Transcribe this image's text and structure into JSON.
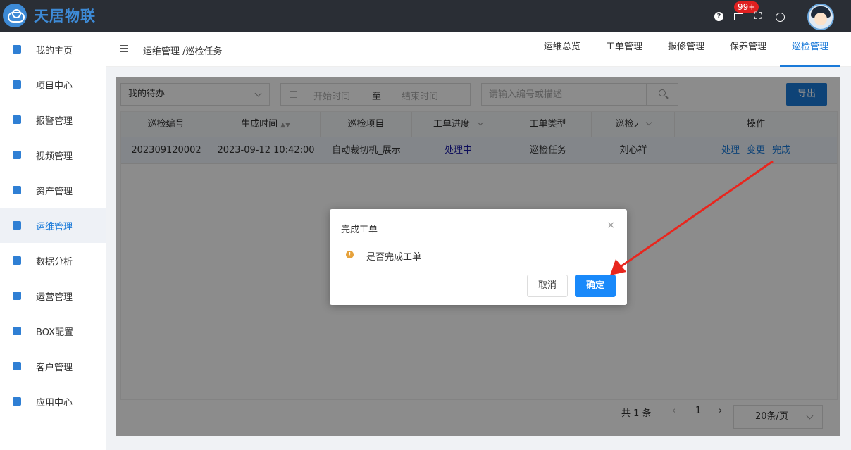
{
  "app": {
    "name": "天居物联"
  },
  "topbar": {
    "badge_count": "99+"
  },
  "sidebar": {
    "items": [
      {
        "label": "我的主页",
        "icon": "home-icon"
      },
      {
        "label": "项目中心",
        "icon": "project-icon"
      },
      {
        "label": "报警管理",
        "icon": "bell-icon"
      },
      {
        "label": "视频管理",
        "icon": "video-icon"
      },
      {
        "label": "资产管理",
        "icon": "asset-icon"
      },
      {
        "label": "运维管理",
        "icon": "gear-icon",
        "active": true
      },
      {
        "label": "数据分析",
        "icon": "monitor-icon"
      },
      {
        "label": "运营管理",
        "icon": "shield-icon"
      },
      {
        "label": "BOX配置",
        "icon": "box-icon"
      },
      {
        "label": "客户管理",
        "icon": "users-icon"
      },
      {
        "label": "应用中心",
        "icon": "apps-icon"
      }
    ]
  },
  "header": {
    "breadcrumb": "运维管理 /巡检任务",
    "tabs": [
      "运维总览",
      "工单管理",
      "报修管理",
      "保养管理",
      "巡检管理"
    ],
    "active_tab": "巡检管理"
  },
  "filters": {
    "status_select": "我的待办",
    "date_start_placeholder": "开始时间",
    "date_separator": "至",
    "date_end_placeholder": "结束时间",
    "search_placeholder": "请输入编号或描述",
    "export_label": "导出"
  },
  "table": {
    "columns": [
      "巡检编号",
      "生成时间",
      "巡检项目",
      "工单进度",
      "工单类型",
      "巡检人",
      "操作"
    ],
    "rows": [
      {
        "id": "202309120002",
        "created": "2023-09-12 10:42:00",
        "project": "自动裁切机_展示",
        "progress": "处理中",
        "type": "巡检任务",
        "inspector": "刘心祥",
        "actions": [
          "处理",
          "变更",
          "完成"
        ]
      }
    ]
  },
  "pagination": {
    "total_label": "共 1 条",
    "current_page": "1",
    "page_size": "20条/页"
  },
  "modal": {
    "title": "完成工单",
    "message": "是否完成工单",
    "cancel_label": "取消",
    "ok_label": "确定"
  },
  "colors": {
    "primary": "#1a7ad9",
    "topbar": "#2a2e35",
    "warning": "#e6a23c",
    "annotation_arrow": "#e8261e"
  }
}
